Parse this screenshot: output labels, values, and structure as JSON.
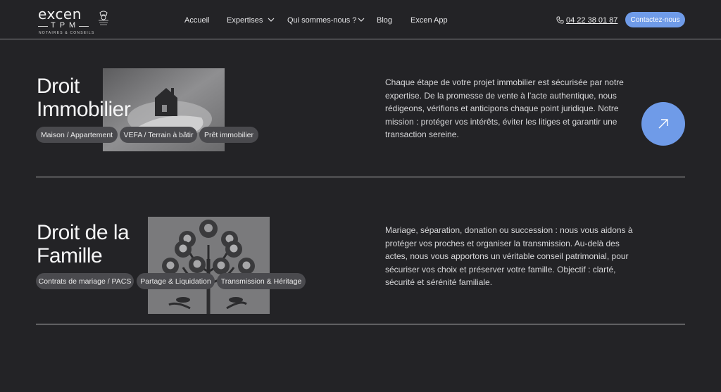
{
  "header": {
    "logo": {
      "main": "excen",
      "sub": "TPM",
      "tagline": "NOTAIRES & CONSEILS"
    },
    "nav": [
      {
        "label": "Accueil",
        "has_dropdown": false
      },
      {
        "label": "Expertises",
        "has_dropdown": true
      },
      {
        "label": "Qui sommes-nous ?",
        "has_dropdown": true
      },
      {
        "label": "Blog",
        "has_dropdown": false
      },
      {
        "label": "Excen App",
        "has_dropdown": false
      }
    ],
    "phone": "04 22 38 01 87",
    "cta_label": "Contactez-nous"
  },
  "sections": [
    {
      "title_line1": "Droit",
      "title_line2": "Immobilier",
      "image_icon": "house-in-hand-image",
      "chips": [
        "Maison / Appartement",
        "VEFA / Terrain à bâtir",
        "Prêt immobilier"
      ],
      "description": "Chaque étape de votre projet immobilier est sécurisée par notre expertise. De la promesse de vente à l’acte authentique, nous rédigeons, vérifions et anticipons chaque point juridique. Notre mission : protéger vos intérêts, éviter les litiges et garantir une transaction sereine."
    },
    {
      "title_line1": "Droit de la",
      "title_line2": "Famille",
      "image_icon": "family-tree-image",
      "chips": [
        "Contrats de mariage / PACS",
        "Partage & Liquidation",
        "Transmission & Héritage"
      ],
      "description": "Mariage, séparation, donation ou succession : nous vous aidons à protéger vos proches et organiser la transmission. Au-delà des actes, nous vous apportons un véritable conseil patrimonial, pour sécuriser vos choix et préserver votre famille. Objectif : clarté, sécurité et sérénité familiale."
    }
  ],
  "colors": {
    "background": "#232326",
    "accent": "#6f9be8",
    "chip": "#4a4a4e",
    "divider": "#b8b8ba"
  },
  "icons": {
    "phone": "phone-icon",
    "dropdown": "chevron-down-icon",
    "arrow": "arrow-up-right-icon"
  }
}
